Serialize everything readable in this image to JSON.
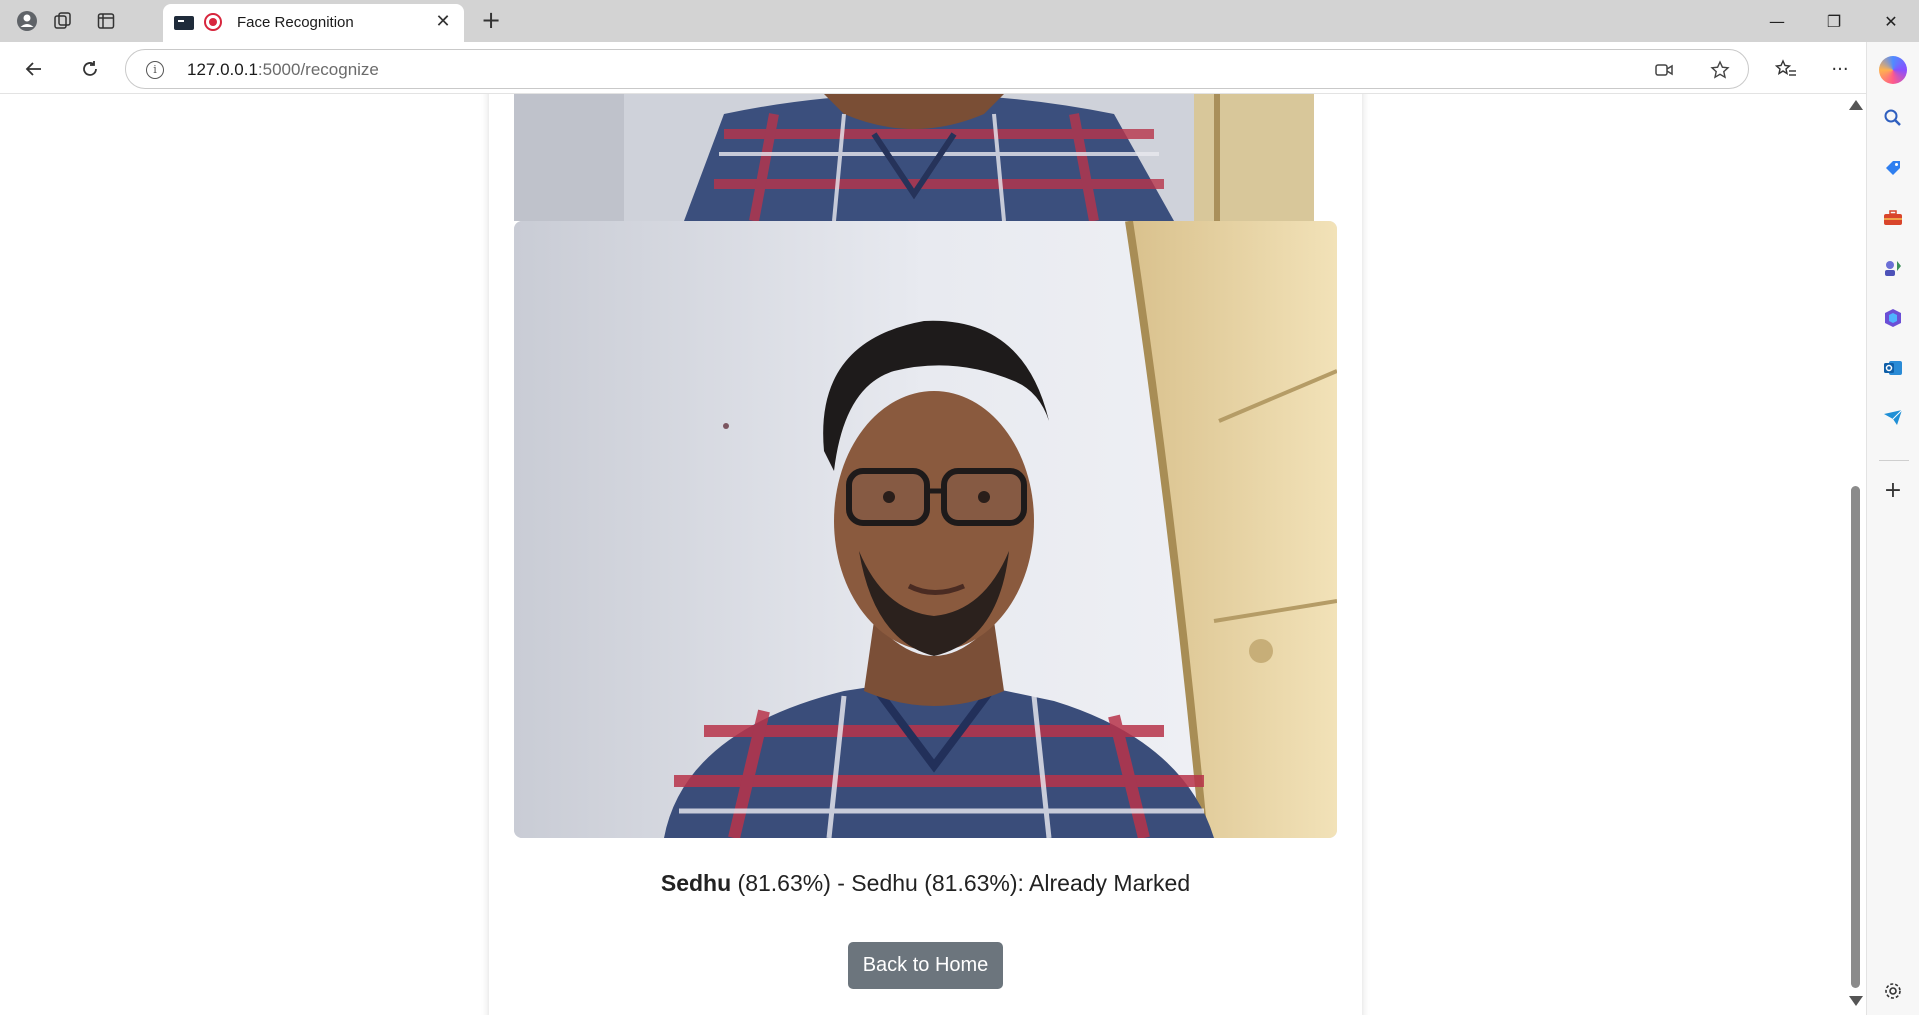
{
  "browser": {
    "tab_title": "Face Recognition",
    "url_host": "127.0.0.1",
    "url_path": ":5000/recognize",
    "new_tab_symbol": "+",
    "tab_close_symbol": "✕",
    "win_minimize": "—",
    "win_restore": "❐",
    "win_close": "✕"
  },
  "page": {
    "result_name": "Sedhu",
    "result_rest": " (81.63%) - Sedhu (81.63%): Already Marked",
    "back_button_label": "Back to Home"
  },
  "colors": {
    "button_bg": "#6c757d",
    "tabbar_bg": "#d3d3d3",
    "record_red": "#d7263d"
  },
  "icons": {
    "sidebar": [
      "search-icon",
      "tag-icon",
      "briefcase-icon",
      "games-icon",
      "office-icon",
      "outlook-icon",
      "send-icon",
      "add-icon",
      "settings-icon"
    ]
  }
}
